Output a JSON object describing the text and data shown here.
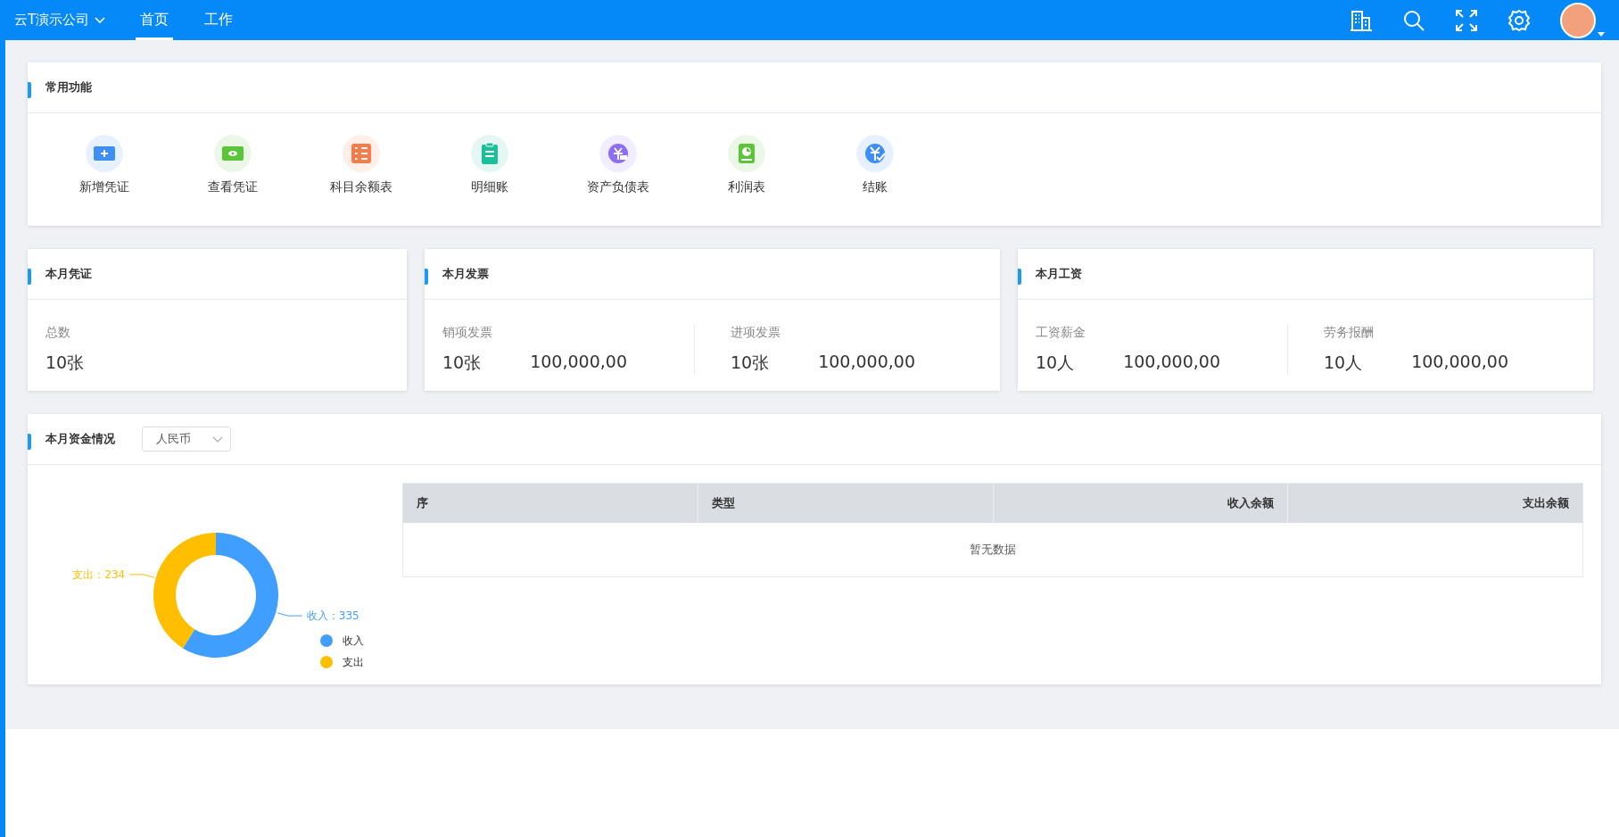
{
  "topbar": {
    "company": "云T演示公司",
    "tabs": [
      {
        "label": "首页",
        "selected": true
      },
      {
        "label": "工作",
        "selected": false
      }
    ]
  },
  "features": {
    "title": "常用功能",
    "items": [
      {
        "label": "新增凭证",
        "color": "#3d8ef5"
      },
      {
        "label": "查看凭证",
        "color": "#5ac53a"
      },
      {
        "label": "科目余额表",
        "color": "#fa7a4a"
      },
      {
        "label": "明细账",
        "color": "#1dbf9a"
      },
      {
        "label": "资产负债表",
        "color": "#8d6ef5"
      },
      {
        "label": "利润表",
        "color": "#5ac53a"
      },
      {
        "label": "结账",
        "color": "#3d8ef5"
      }
    ]
  },
  "stat_cards": [
    {
      "title": "本月凭证",
      "groups": [
        {
          "label": "总数",
          "count": "10张"
        }
      ]
    },
    {
      "title": "本月发票",
      "groups": [
        {
          "label": "销项发票",
          "count": "10张",
          "amount": "100,000,00"
        },
        {
          "label": "进项发票",
          "count": "10张",
          "amount": "100,000,00"
        }
      ]
    },
    {
      "title": "本月工资",
      "groups": [
        {
          "label": "工资薪金",
          "count": "10人",
          "amount": "100,000,00"
        },
        {
          "label": "劳务报酬",
          "count": "10人",
          "amount": "100,000,00"
        }
      ]
    }
  ],
  "funds": {
    "title": "本月资金情况",
    "currency": "人民币",
    "chart_data": {
      "type": "donut",
      "categories": [
        "收入",
        "支出"
      ],
      "values": [
        335,
        234
      ],
      "colors": [
        "#409eff",
        "#ffbf00"
      ],
      "value_labels": [
        "收入：335",
        "支出：234"
      ],
      "legend": "bottom-right"
    },
    "table": {
      "columns": [
        {
          "label": "序",
          "right_aligned": false
        },
        {
          "label": "类型",
          "right_aligned": false
        },
        {
          "label": "收入余额",
          "right_aligned": true
        },
        {
          "label": "支出余额",
          "right_aligned": true
        }
      ],
      "empty_text": "暂无数据"
    }
  }
}
